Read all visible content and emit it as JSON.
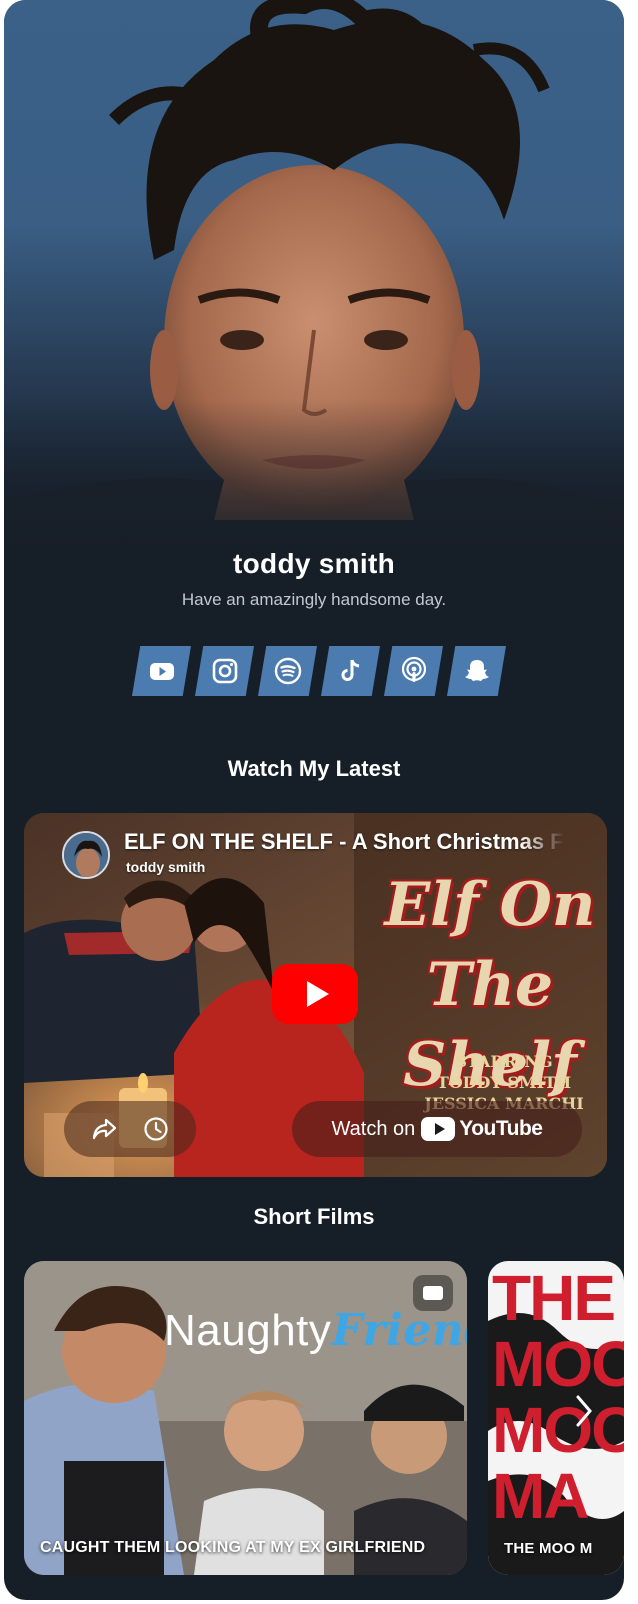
{
  "profile": {
    "name": "toddy smith",
    "bio": "Have an amazingly handsome day."
  },
  "socials": [
    {
      "name": "youtube-icon"
    },
    {
      "name": "instagram-icon"
    },
    {
      "name": "spotify-icon"
    },
    {
      "name": "tiktok-icon"
    },
    {
      "name": "podcast-icon"
    },
    {
      "name": "snapchat-icon"
    }
  ],
  "sections": {
    "latest": "Watch My Latest",
    "short_films": "Short Films"
  },
  "video": {
    "title": "ELF ON THE SHELF - A Short Christmas F",
    "channel": "toddy smith",
    "thumb_title_line1": "Elf On",
    "thumb_title_line2": "The Shelf",
    "credit_1": "STARRING",
    "credit_2": "TODDY SMITH",
    "credit_3": "JESSICA MARCHI",
    "watch_on": "Watch on",
    "youtube_word": "YouTube"
  },
  "short_films": [
    {
      "caption": "CAUGHT THEM LOOKING AT MY EX GIRLFRIEND",
      "overlay_a": "Naughty",
      "overlay_b": "Friend"
    },
    {
      "caption": "THE MOO M",
      "overlay_lines": [
        "THE",
        "MOO",
        "MOO",
        "MA"
      ]
    }
  ],
  "colors": {
    "background": "#161e28",
    "social_tile": "#4c7bb0",
    "youtube_red": "#ff0000"
  }
}
